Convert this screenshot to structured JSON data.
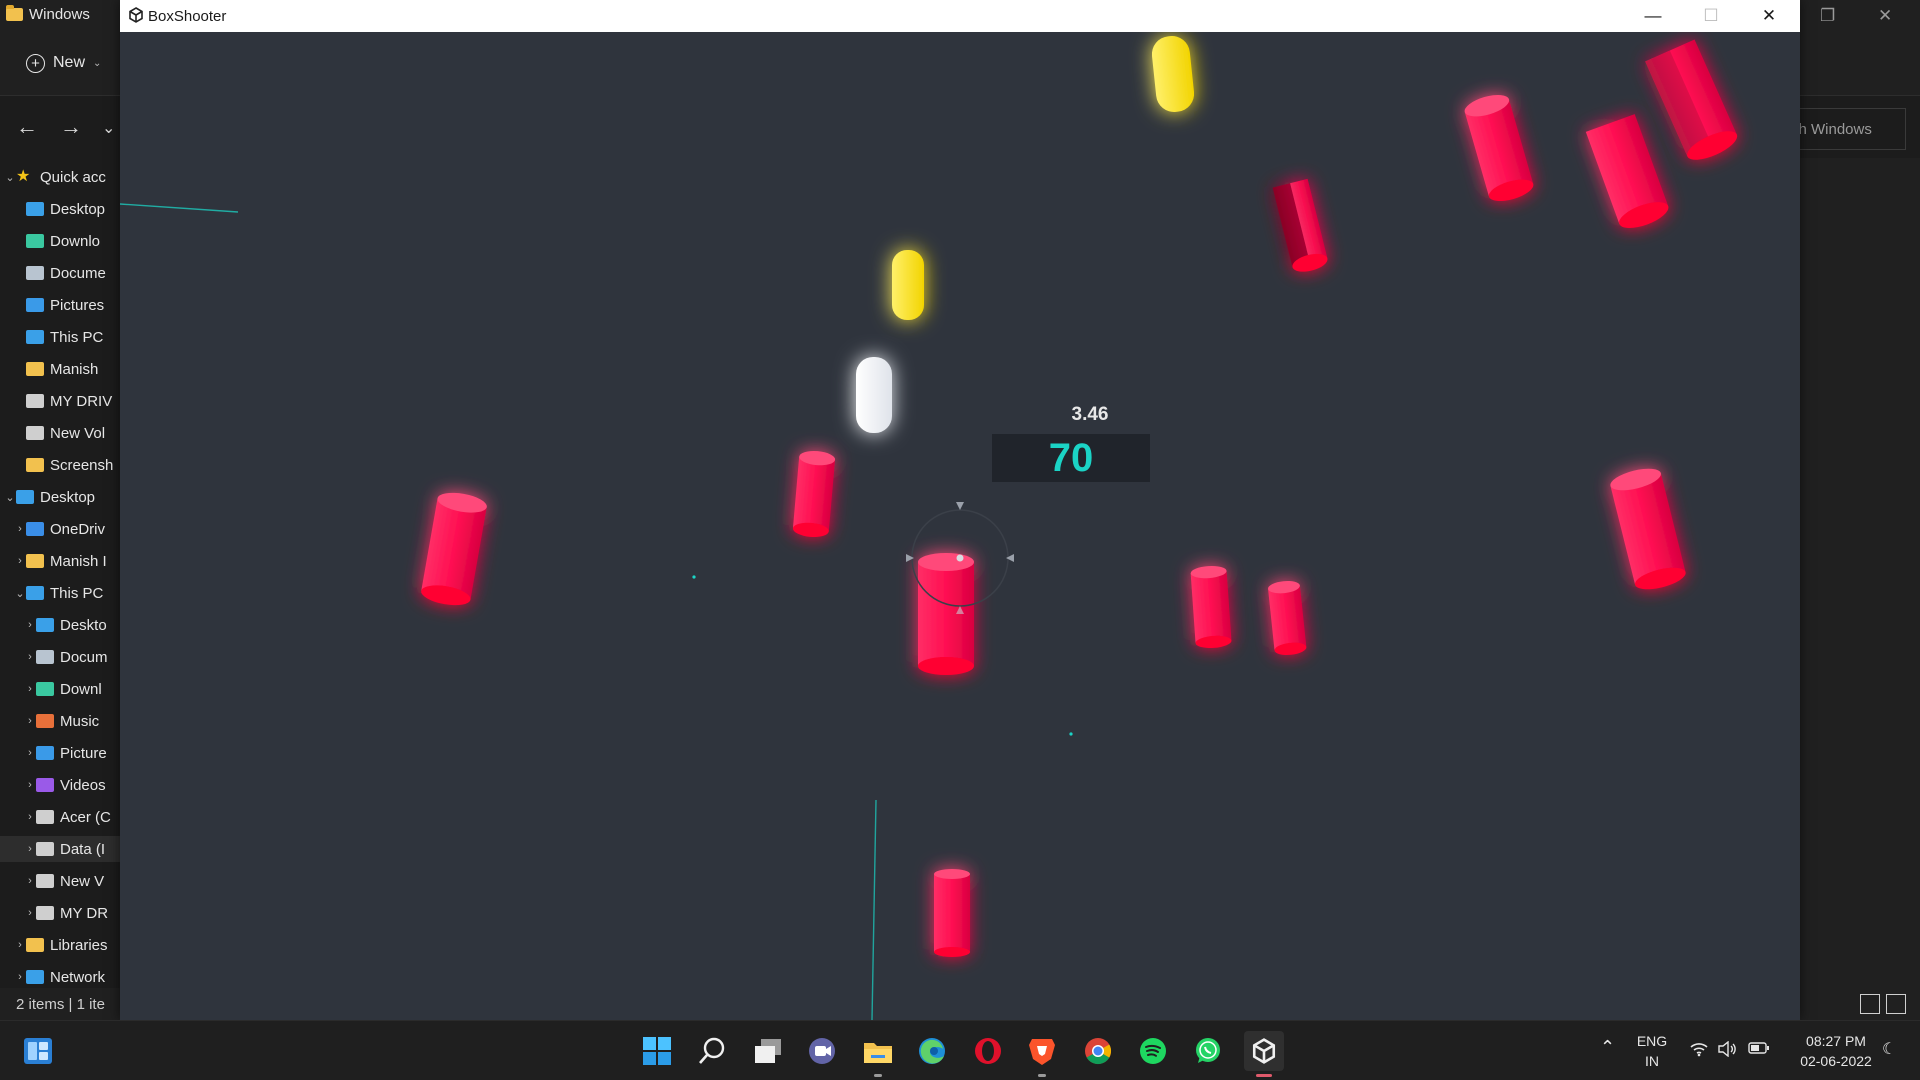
{
  "explorer": {
    "window_title": "Windows",
    "new_label": "New",
    "search_placeholder": "ch Windows",
    "sidebar": [
      {
        "label": "Quick acc",
        "icon": "star-icon",
        "color": "#f5c518",
        "indent": 0,
        "expanded": true
      },
      {
        "label": "Desktop",
        "icon": "desktop-icon",
        "color": "#3aa0e8",
        "indent": 1
      },
      {
        "label": "Downlo",
        "icon": "download-icon",
        "color": "#3ac8a0",
        "indent": 1
      },
      {
        "label": "Docume",
        "icon": "document-icon",
        "color": "#b8c4d0",
        "indent": 1
      },
      {
        "label": "Pictures",
        "icon": "pictures-icon",
        "color": "#3a9ae8",
        "indent": 1
      },
      {
        "label": "This PC",
        "icon": "monitor-icon",
        "color": "#3aa0e8",
        "indent": 1
      },
      {
        "label": "Manish",
        "icon": "folder-icon",
        "color": "#f2c14e",
        "indent": 1
      },
      {
        "label": "MY DRIV",
        "icon": "drive-icon",
        "color": "#cfcfcf",
        "indent": 1
      },
      {
        "label": "New Vol",
        "icon": "drive-icon",
        "color": "#cfcfcf",
        "indent": 1
      },
      {
        "label": "Screensh",
        "icon": "folder-icon",
        "color": "#f2c14e",
        "indent": 1
      },
      {
        "label": "Desktop",
        "icon": "desktop-icon",
        "color": "#3aa0e8",
        "indent": 0,
        "expanded": true
      },
      {
        "label": "OneDriv",
        "icon": "cloud-icon",
        "color": "#3a8ee8",
        "indent": 1,
        "collapsed": true
      },
      {
        "label": "Manish I",
        "icon": "folder-icon",
        "color": "#f2c14e",
        "indent": 1,
        "collapsed": true
      },
      {
        "label": "This PC",
        "icon": "monitor-icon",
        "color": "#3aa0e8",
        "indent": 1,
        "expanded": true
      },
      {
        "label": "Deskto",
        "icon": "desktop-icon",
        "color": "#3aa0e8",
        "indent": 2,
        "collapsed": true
      },
      {
        "label": "Docum",
        "icon": "document-icon",
        "color": "#b8c4d0",
        "indent": 2,
        "collapsed": true
      },
      {
        "label": "Downl",
        "icon": "download-icon",
        "color": "#3ac8a0",
        "indent": 2,
        "collapsed": true
      },
      {
        "label": "Music",
        "icon": "music-icon",
        "color": "#e8703a",
        "indent": 2,
        "collapsed": true
      },
      {
        "label": "Picture",
        "icon": "pictures-icon",
        "color": "#3a9ae8",
        "indent": 2,
        "collapsed": true
      },
      {
        "label": "Videos",
        "icon": "video-icon",
        "color": "#9a5ae8",
        "indent": 2,
        "collapsed": true
      },
      {
        "label": "Acer (C",
        "icon": "drive-icon",
        "color": "#cfcfcf",
        "indent": 2,
        "collapsed": true
      },
      {
        "label": "Data (I",
        "icon": "drive-icon",
        "color": "#cfcfcf",
        "indent": 2,
        "collapsed": true,
        "selected": true
      },
      {
        "label": "New V",
        "icon": "drive-icon",
        "color": "#cfcfcf",
        "indent": 2,
        "collapsed": true
      },
      {
        "label": "MY DR",
        "icon": "drive-icon",
        "color": "#cfcfcf",
        "indent": 2,
        "collapsed": true
      },
      {
        "label": "Libraries",
        "icon": "folder-icon",
        "color": "#f2c14e",
        "indent": 1,
        "collapsed": true
      },
      {
        "label": "Network",
        "icon": "network-icon",
        "color": "#3aa0e8",
        "indent": 1,
        "collapsed": true
      }
    ],
    "status_text": "2 items  |  1 ite"
  },
  "game": {
    "window_title": "BoxShooter",
    "timer": "3.46",
    "score": "70",
    "colors": {
      "background": "#2f343d",
      "enemy": "#ff1e5a",
      "bonus": "#ffe81a",
      "extra_time": "#ffffff",
      "score_text": "#1bd4c6",
      "laser": "#1bd4c6"
    }
  },
  "taskbar": {
    "apps": [
      "start-icon",
      "search-icon",
      "task-view-icon",
      "teams-chat-icon",
      "file-explorer-icon",
      "edge-icon",
      "opera-icon",
      "brave-icon",
      "chrome-icon",
      "spotify-icon",
      "whatsapp-icon",
      "unity-icon"
    ],
    "language": "ENG",
    "region": "IN",
    "time": "08:27 PM",
    "date": "02-06-2022"
  }
}
